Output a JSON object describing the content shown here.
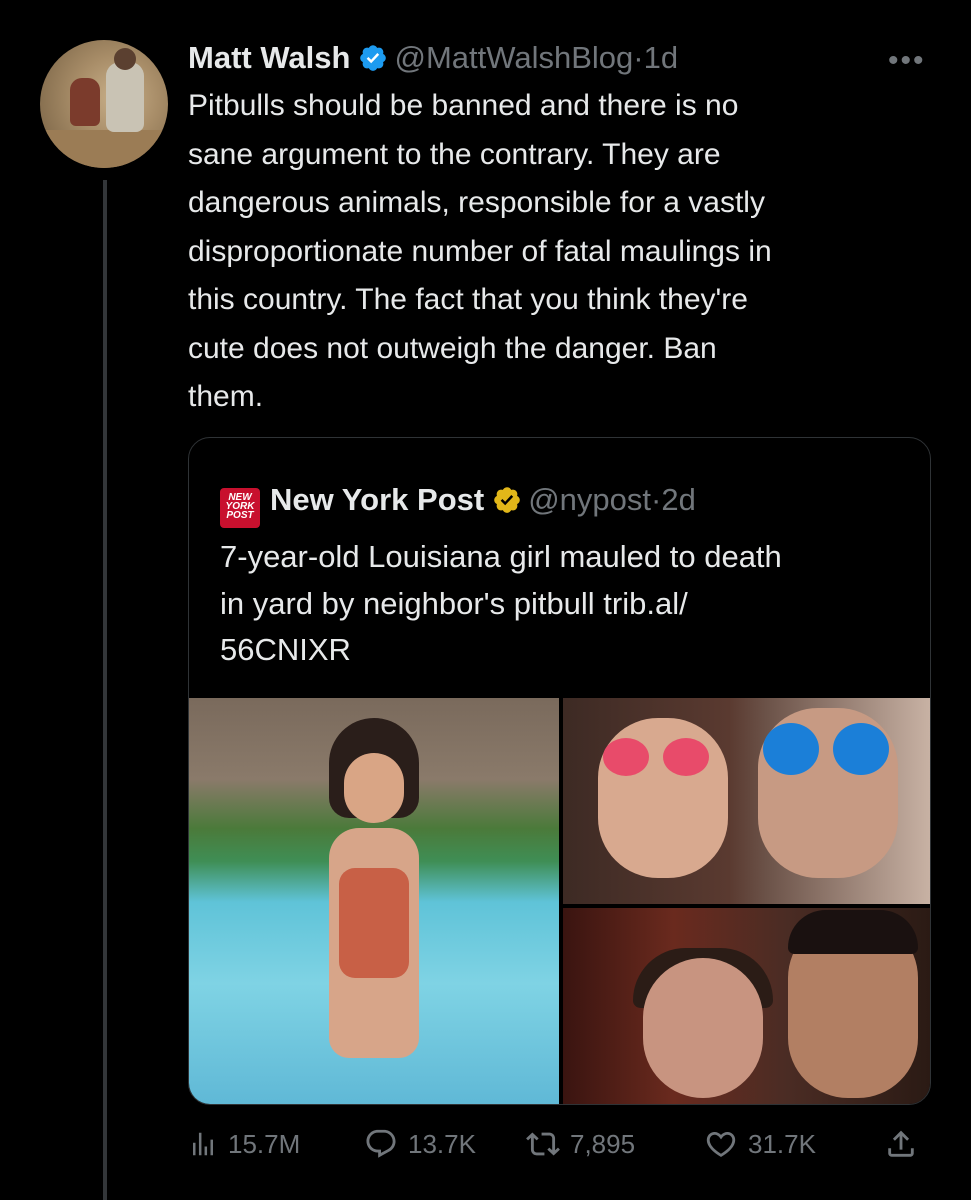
{
  "tweet": {
    "author_name": "Matt Walsh",
    "handle": "@MattWalshBlog",
    "separator": "·",
    "time": "1d",
    "more_label": "•••",
    "text": "Pitbulls should be banned and there is no\nsane argument to the contrary. They are\ndangerous animals, responsible for a vastly\ndisproportionate number of fatal maulings in\nthis country. The fact that you think they're\ncute does not outweigh the danger. Ban\nthem."
  },
  "quote": {
    "logo_text": "NEW\nYORK\nPOST",
    "author_name": "New York Post",
    "handle": "@nypost",
    "separator": "·",
    "time": "2d",
    "text": "7-year-old Louisiana girl mauled to death\nin yard by neighbor's pitbull trib.al/\n56CNIXR"
  },
  "actions": {
    "views": "15.7M",
    "replies": "13.7K",
    "retweets": "7,895",
    "likes": "31.7K"
  },
  "colors": {
    "background": "#000000",
    "text": "#e7e9ea",
    "muted": "#71767b",
    "verified_blue": "#1d9bf0",
    "verified_gold": "#e2b719",
    "nypost_red": "#c8102e"
  },
  "icons": [
    "verified-badge-icon",
    "more-icon",
    "views-icon",
    "reply-icon",
    "retweet-icon",
    "like-icon",
    "share-icon"
  ]
}
